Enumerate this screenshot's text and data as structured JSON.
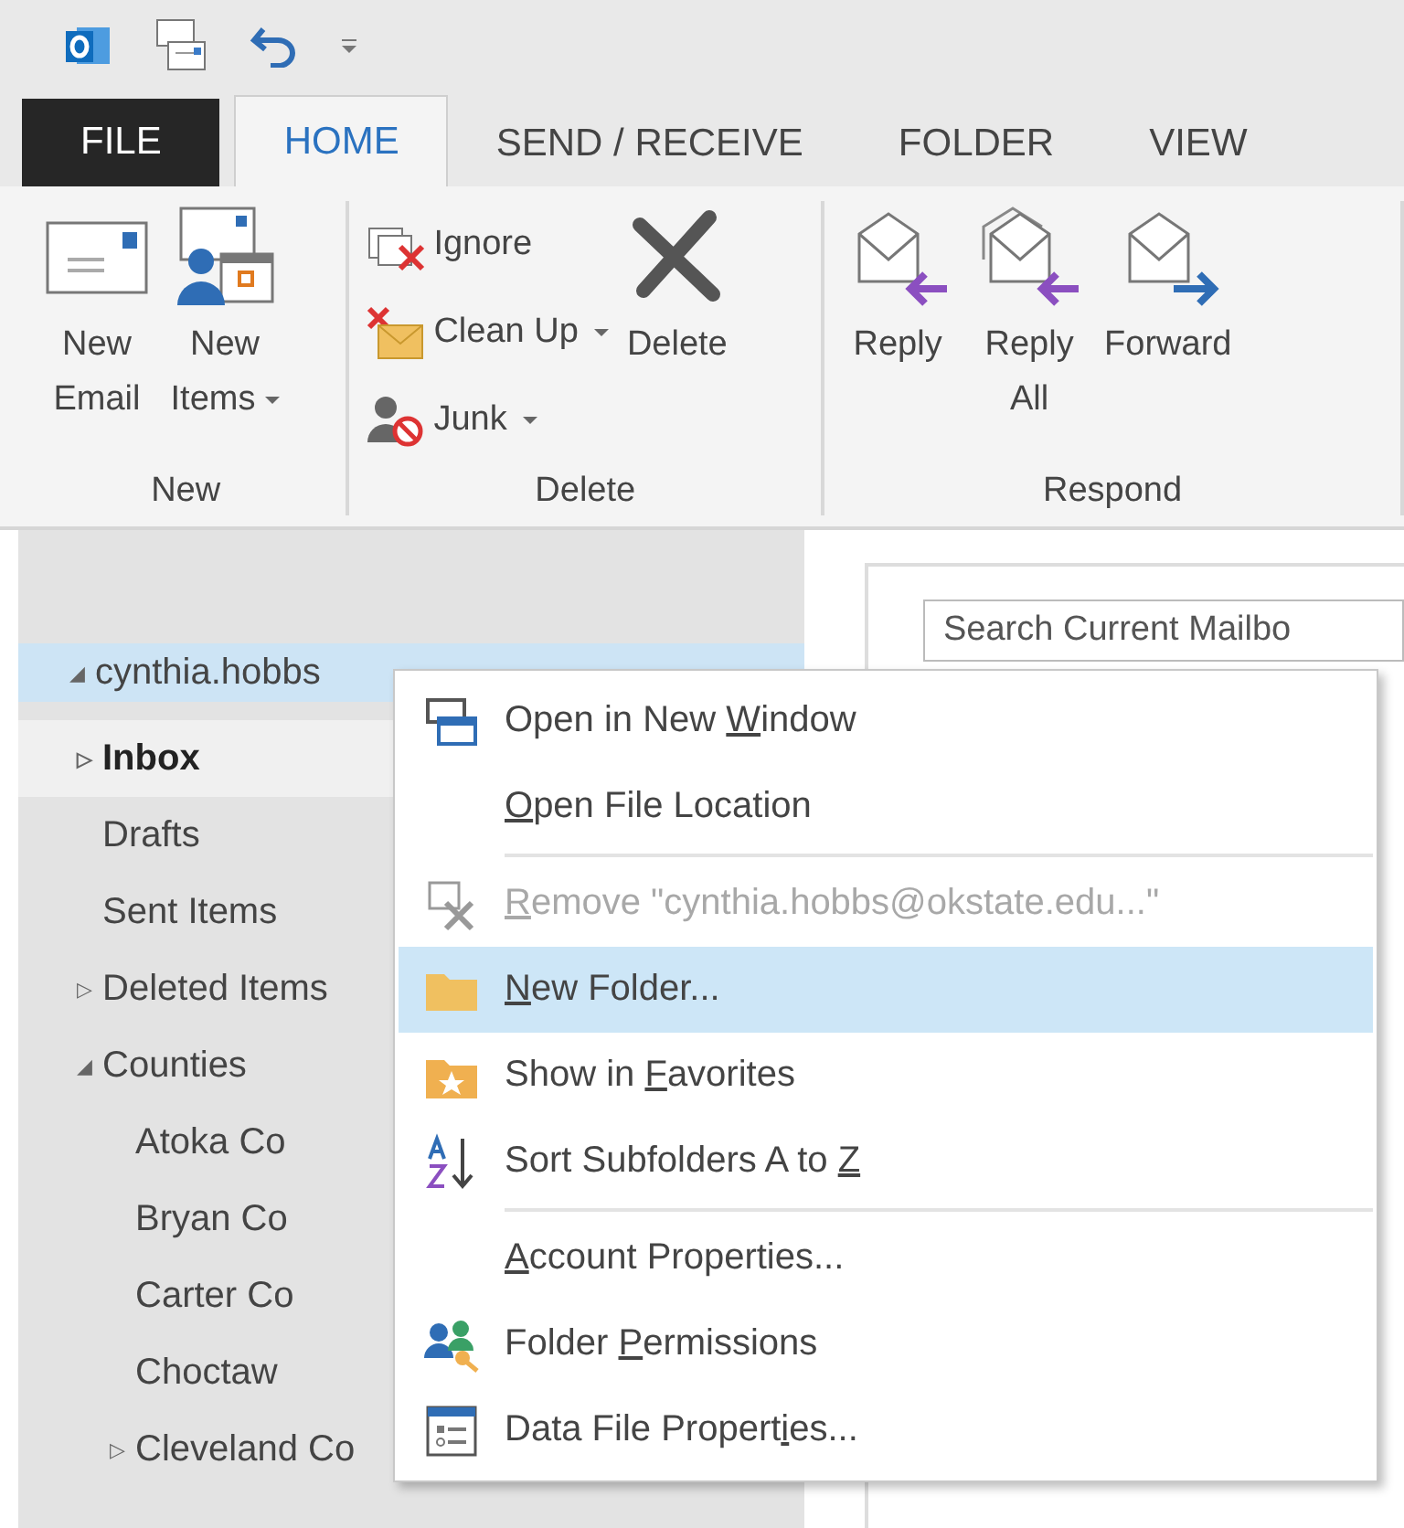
{
  "tabs": [
    {
      "label": "FILE",
      "kind": "file",
      "selected": false
    },
    {
      "label": "HOME",
      "kind": "tab",
      "selected": true
    },
    {
      "label": "SEND / RECEIVE",
      "kind": "tab",
      "selected": false
    },
    {
      "label": "FOLDER",
      "kind": "tab",
      "selected": false
    },
    {
      "label": "VIEW",
      "kind": "tab",
      "selected": false
    }
  ],
  "ribbon": [
    {
      "label": "New",
      "buttons": [
        {
          "kind": "large",
          "lines": [
            "New",
            "Email"
          ],
          "dropdown": false
        },
        {
          "kind": "large",
          "lines": [
            "New",
            "Items"
          ],
          "dropdown": true
        }
      ]
    },
    {
      "label": "Delete",
      "buttons": [
        {
          "kind": "stack",
          "items": [
            {
              "label": "Ignore",
              "dropdown": false
            },
            {
              "label": "Clean Up",
              "dropdown": true
            },
            {
              "label": "Junk",
              "dropdown": true
            }
          ]
        },
        {
          "kind": "large",
          "lines": [
            "Delete"
          ],
          "dropdown": false
        }
      ]
    },
    {
      "label": "Respond",
      "buttons": [
        {
          "kind": "large",
          "lines": [
            "Reply"
          ],
          "dropdown": false
        },
        {
          "kind": "large",
          "lines": [
            "Reply",
            "All"
          ],
          "dropdown": false
        },
        {
          "kind": "large",
          "lines": [
            "Forward"
          ],
          "dropdown": false
        }
      ]
    }
  ],
  "folder_pane": {
    "account": {
      "label": "cynthia.hobbs",
      "arrow": "◢",
      "selected": true,
      "unread": false,
      "children": [
        {
          "label": "Inbox",
          "arrow": "▷",
          "selected": false,
          "hover": true,
          "unread": true
        },
        {
          "label": "Drafts",
          "selected": false,
          "hover": false,
          "unread": false
        },
        {
          "label": "Sent Items",
          "selected": false,
          "hover": false,
          "unread": false
        },
        {
          "label": "Deleted Items",
          "arrow": "▷",
          "selected": false,
          "hover": false,
          "unread": false
        },
        {
          "label": "Counties",
          "arrow": "◢",
          "selected": false,
          "hover": false,
          "unread": false,
          "children": [
            {
              "label": "Atoka Co",
              "selected": false,
              "hover": false,
              "unread": false
            },
            {
              "label": "Bryan Co",
              "selected": false,
              "hover": false,
              "unread": false
            },
            {
              "label": "Carter Co",
              "selected": false,
              "hover": false,
              "unread": false
            },
            {
              "label": "Choctaw",
              "selected": false,
              "hover": false,
              "unread": false
            },
            {
              "label": "Cleveland Co",
              "arrow": "▷",
              "selected": false,
              "hover": false,
              "unread": false
            }
          ]
        }
      ]
    }
  },
  "search": {
    "placeholder": "Search Current Mailbo"
  },
  "context_menu": [
    {
      "kind": "item",
      "before": "Open in New ",
      "key": "W",
      "after": "indow",
      "disabled": false,
      "selected": false
    },
    {
      "kind": "item",
      "key": "O",
      "after": "pen File Location",
      "disabled": false,
      "selected": false
    },
    {
      "kind": "separator"
    },
    {
      "kind": "item",
      "key": "R",
      "after": "emove \"cynthia.hobbs@okstate.edu...\"",
      "disabled": true,
      "selected": false
    },
    {
      "kind": "item",
      "key": "N",
      "after": "ew Folder...",
      "disabled": false,
      "selected": true
    },
    {
      "kind": "item",
      "before": "Show in ",
      "key": "F",
      "after": "avorites",
      "disabled": false,
      "selected": false
    },
    {
      "kind": "item",
      "before": "Sort Subfolders A to ",
      "key": "Z",
      "disabled": false,
      "selected": false
    },
    {
      "kind": "separator"
    },
    {
      "kind": "item",
      "key": "A",
      "after": "ccount Properties...",
      "disabled": false,
      "selected": false
    },
    {
      "kind": "item",
      "before": "Folder ",
      "key": "P",
      "after": "ermissions",
      "disabled": false,
      "selected": false
    },
    {
      "kind": "item",
      "before": "Data File Propert",
      "key": "i",
      "after": "es...",
      "disabled": false,
      "selected": false
    }
  ]
}
